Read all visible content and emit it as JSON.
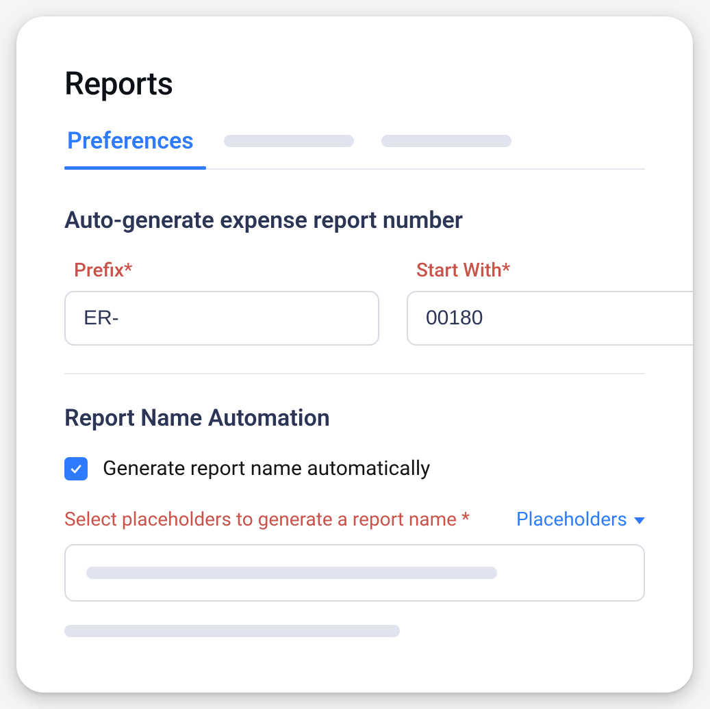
{
  "page": {
    "title": "Reports"
  },
  "tabs": {
    "active": "Preferences"
  },
  "sections": {
    "autogen": {
      "title": "Auto-generate expense report number",
      "prefix_label": "Prefix*",
      "prefix_value": "ER-",
      "start_label": "Start With*",
      "start_value": "00180"
    },
    "name_automation": {
      "title": "Report Name Automation",
      "checkbox_label": "Generate report name automatically",
      "checkbox_checked": true,
      "select_label": "Select placeholders to generate a report name *",
      "placeholders_link": "Placeholders"
    }
  }
}
